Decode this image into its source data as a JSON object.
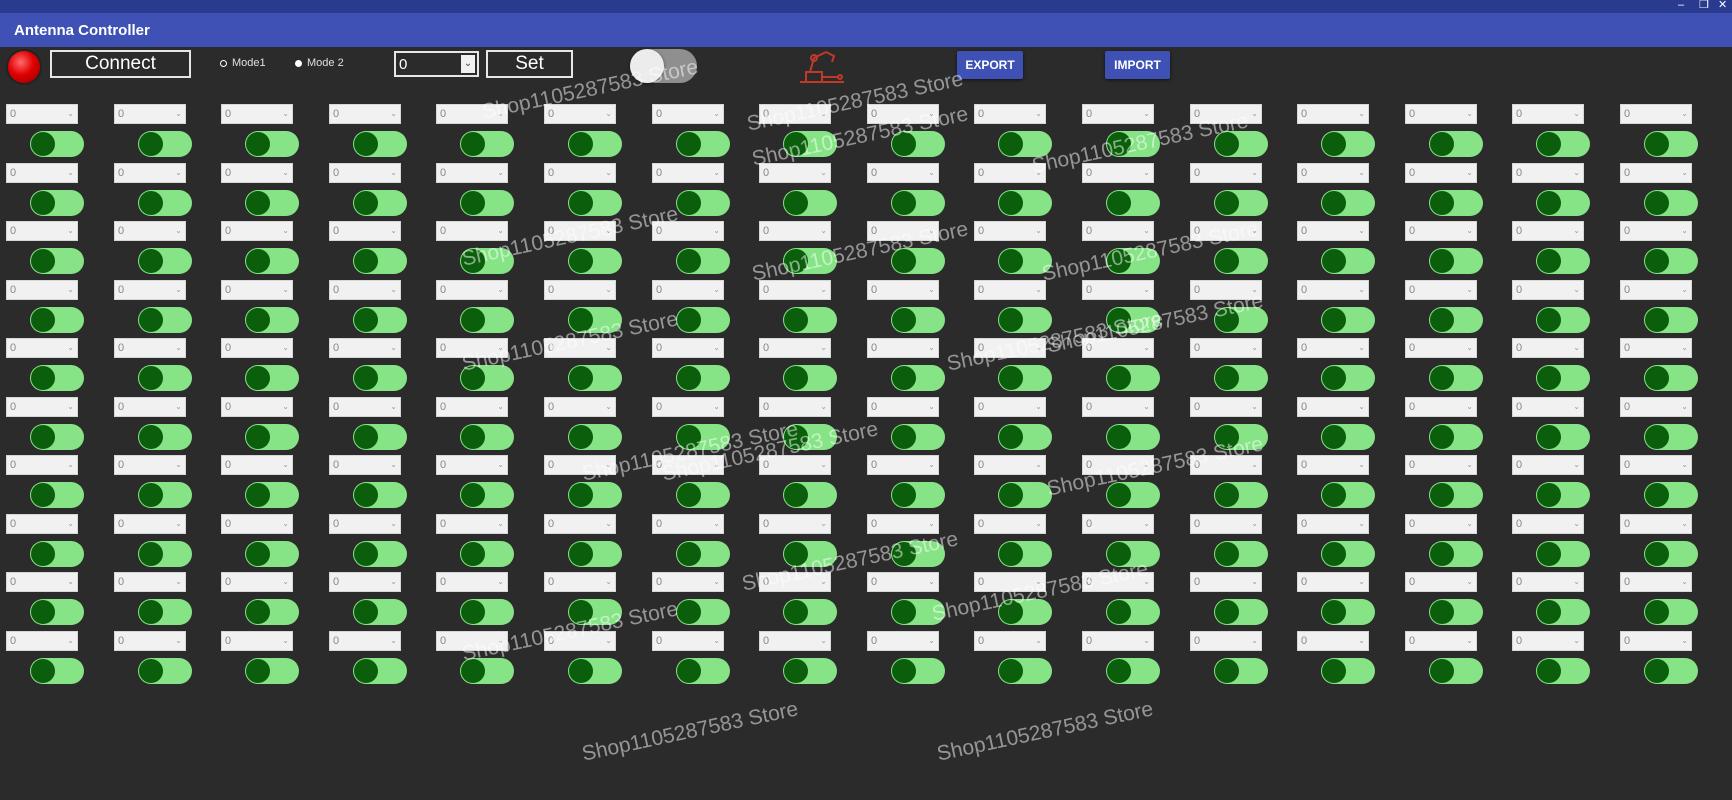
{
  "window": {
    "title": "Antenna Controller",
    "controls": {
      "minimize": "–",
      "maximize": "❐",
      "close": "✕"
    }
  },
  "toolbar": {
    "connect_label": "Connect",
    "mode1_label": "Mode1",
    "mode2_label": "Mode 2",
    "mode_selected": "Mode 2",
    "value_combo": "0",
    "set_label": "Set",
    "master_toggle_on": false,
    "export_label": "EXPORT",
    "import_label": "IMPORT",
    "led_state": "disconnected",
    "led_color": "#e00000",
    "accent_color": "#3f51b5",
    "icons": {
      "led": "status-led-icon",
      "logo": "robot-arm-logo-icon",
      "dropdown": "chevron-down-icon"
    }
  },
  "grid": {
    "rows": 10,
    "columns": 16,
    "combo_value": "0",
    "switch_state": "on",
    "switch_track_color": "#86e486",
    "switch_knob_color": "#0b5e0b"
  },
  "watermark": {
    "text": "Shop1105287583 Store"
  }
}
